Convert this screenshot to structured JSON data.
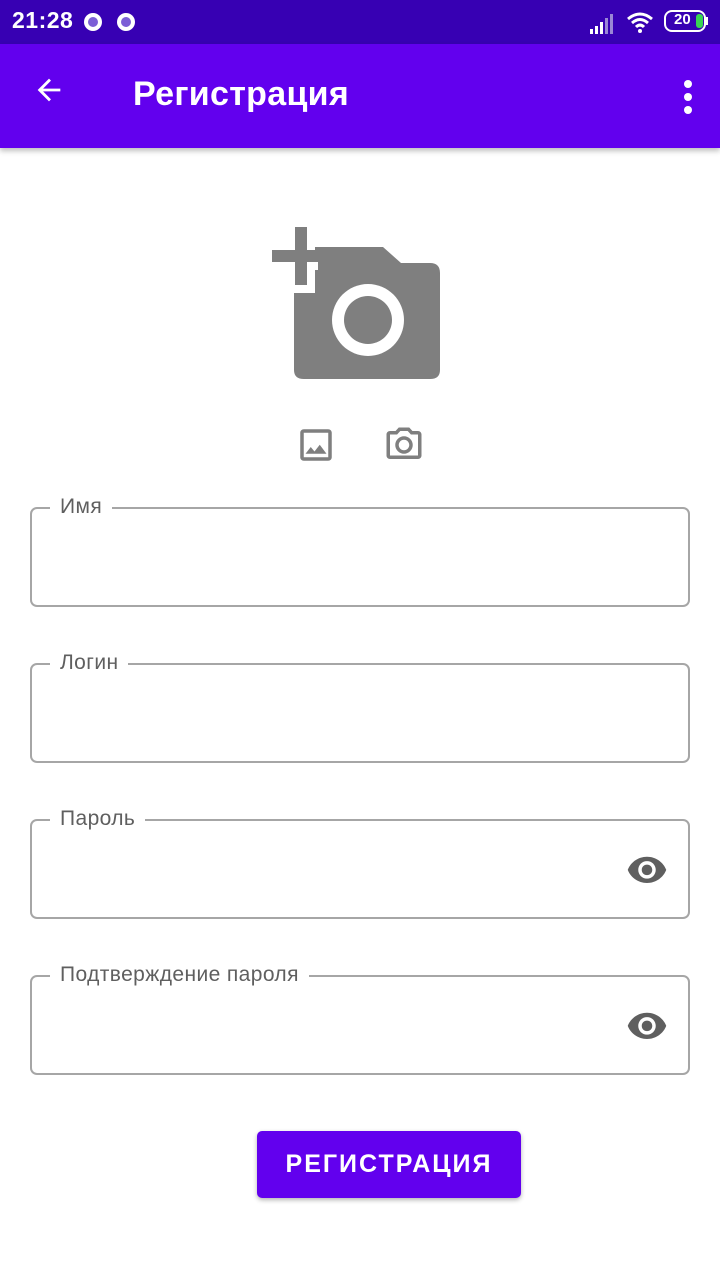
{
  "status_bar": {
    "time": "21:28",
    "battery_level": "20",
    "icons": [
      "notification-dot-icon",
      "notification-dot-icon",
      "signal-icon",
      "wifi-icon",
      "battery-icon"
    ]
  },
  "app_bar": {
    "title": "Регистрация",
    "back_icon": "arrow-back-icon",
    "menu_icon": "more-vert-icon"
  },
  "avatar": {
    "icon": "add-a-photo-icon",
    "gallery_icon": "image-icon",
    "camera_icon": "camera-icon"
  },
  "form": {
    "fields": [
      {
        "label": "Имя",
        "value": "",
        "type": "text"
      },
      {
        "label": "Логин",
        "value": "",
        "type": "text"
      },
      {
        "label": "Пароль",
        "value": "",
        "type": "password",
        "toggle_icon": "eye-icon"
      },
      {
        "label": "Подтверждение пароля",
        "value": "",
        "type": "password",
        "toggle_icon": "eye-icon"
      }
    ],
    "submit_label": "РЕГИСТРАЦИЯ"
  },
  "colors": {
    "status_bar": "#3700b3",
    "primary": "#6200ee",
    "icon_gray": "#7f7f7f",
    "outline": "#a6a6a6",
    "label": "#5f5f5f"
  }
}
